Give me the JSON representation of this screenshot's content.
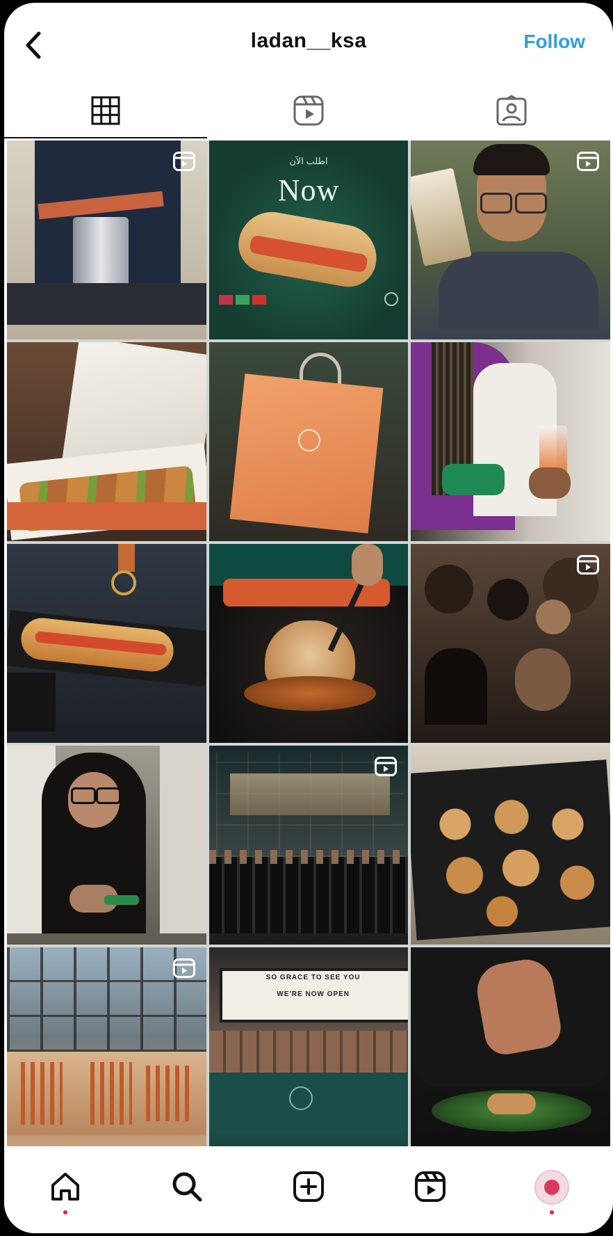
{
  "header": {
    "username": "ladan__ksa",
    "follow_label": "Follow"
  },
  "tabs": [
    {
      "icon": "grid-icon",
      "active": true
    },
    {
      "icon": "reels-icon",
      "active": false
    },
    {
      "icon": "tagged-icon",
      "active": false
    }
  ],
  "posts": [
    {
      "is_reel": true
    },
    {
      "is_reel": false,
      "headline": "Now",
      "subheadline": "اطلب الآن"
    },
    {
      "is_reel": true
    },
    {
      "is_reel": false
    },
    {
      "is_reel": false
    },
    {
      "is_reel": false
    },
    {
      "is_reel": false
    },
    {
      "is_reel": false
    },
    {
      "is_reel": true
    },
    {
      "is_reel": false
    },
    {
      "is_reel": true
    },
    {
      "is_reel": false
    },
    {
      "is_reel": true
    },
    {
      "is_reel": false,
      "marquee_line1": "SO GRACE TO SEE YOU",
      "marquee_line2": "WE'RE NOW OPEN"
    },
    {
      "is_reel": false
    }
  ],
  "bottom_nav": [
    {
      "icon": "home-icon",
      "notification": true
    },
    {
      "icon": "search-icon",
      "notification": false
    },
    {
      "icon": "create-icon",
      "notification": false
    },
    {
      "icon": "reels-icon",
      "notification": false
    },
    {
      "icon": "profile-avatar",
      "notification": true
    }
  ],
  "colors": {
    "follow": "#2f9fe0",
    "notification_dot": "#e0244c",
    "brand_green": "#1d4a3c",
    "brand_orange": "#e8905a"
  }
}
